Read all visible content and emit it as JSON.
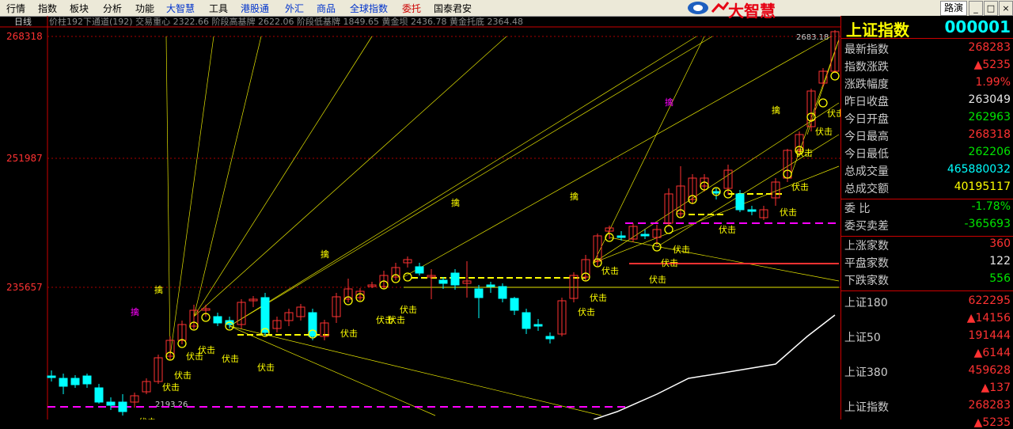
{
  "menu": {
    "items": [
      {
        "label": "行情",
        "style": ""
      },
      {
        "label": "指数",
        "style": ""
      },
      {
        "label": "板块",
        "style": ""
      },
      {
        "label": "分析",
        "style": ""
      },
      {
        "label": "功能",
        "style": ""
      },
      {
        "label": "大智慧",
        "style": "blue"
      },
      {
        "label": "工具",
        "style": ""
      },
      {
        "label": "港股通",
        "style": "blue"
      },
      {
        "label": "外汇",
        "style": "blue"
      },
      {
        "label": "商品",
        "style": "blue"
      },
      {
        "label": "全球指数",
        "style": "blue"
      },
      {
        "label": "委托",
        "style": "red"
      },
      {
        "label": "国泰君安",
        "style": ""
      }
    ],
    "brand": "大智慧",
    "search_button": "路演",
    "min_symbol": "_",
    "max_symbol": "□",
    "close_symbol": "×"
  },
  "chart": {
    "period_tab": "日线",
    "header_text": "价柱192下通道(192)  交易重心  2322.66  阶段高基牌  2622.06  阶段低基牌  1849.65  黄金坝  2436.78  黄金托底  2364.48",
    "y_labels": [
      "268318",
      "251987",
      "235657"
    ],
    "price_high_label": "2683.18",
    "price_low_label": "2193.26",
    "signal_word": "伏击",
    "grab_word": "擒",
    "colors": {
      "up": "#ff3232",
      "down": "#00ffff",
      "signal": "#ffff00",
      "fan": "#e6e600",
      "dash": "#ff00ff",
      "accent": "#ff00ff"
    }
  },
  "quote": {
    "name": "上证指数",
    "code": "000001",
    "rows": [
      {
        "label": "最新指数",
        "value": "268283",
        "color": "red"
      },
      {
        "label": "指数涨跌",
        "value": "▲5235",
        "color": "red"
      },
      {
        "label": "涨跌幅度",
        "value": "1.99%",
        "color": "red"
      },
      {
        "label": "昨日收盘",
        "value": "263049",
        "color": "white"
      },
      {
        "label": "今日开盘",
        "value": "262963",
        "color": "green"
      },
      {
        "label": "今日最高",
        "value": "268318",
        "color": "red"
      },
      {
        "label": "今日最低",
        "value": "262206",
        "color": "green"
      },
      {
        "label": "总成交量",
        "value": "465880032",
        "color": "cyan"
      },
      {
        "label": "总成交额",
        "value": "40195117",
        "color": "yellow"
      }
    ],
    "rows2": [
      {
        "label": "委    比",
        "value": "-1.78%",
        "color": "green"
      },
      {
        "label": "委买卖差",
        "value": "-365693",
        "color": "green"
      }
    ],
    "rows3": [
      {
        "label": "上涨家数",
        "value": "360",
        "color": "red"
      },
      {
        "label": "平盘家数",
        "value": "122",
        "color": "white"
      },
      {
        "label": "下跌家数",
        "value": "556",
        "color": "green"
      }
    ],
    "indices": [
      {
        "label": "上证180",
        "value": "622295",
        "change": "▲14156"
      },
      {
        "label": "上证50",
        "value": "191444",
        "change": "▲6144"
      },
      {
        "label": "上证380",
        "value": "459628",
        "change": "▲137"
      },
      {
        "label": "上证指数",
        "value": "268283",
        "change": "▲5235"
      }
    ]
  }
}
